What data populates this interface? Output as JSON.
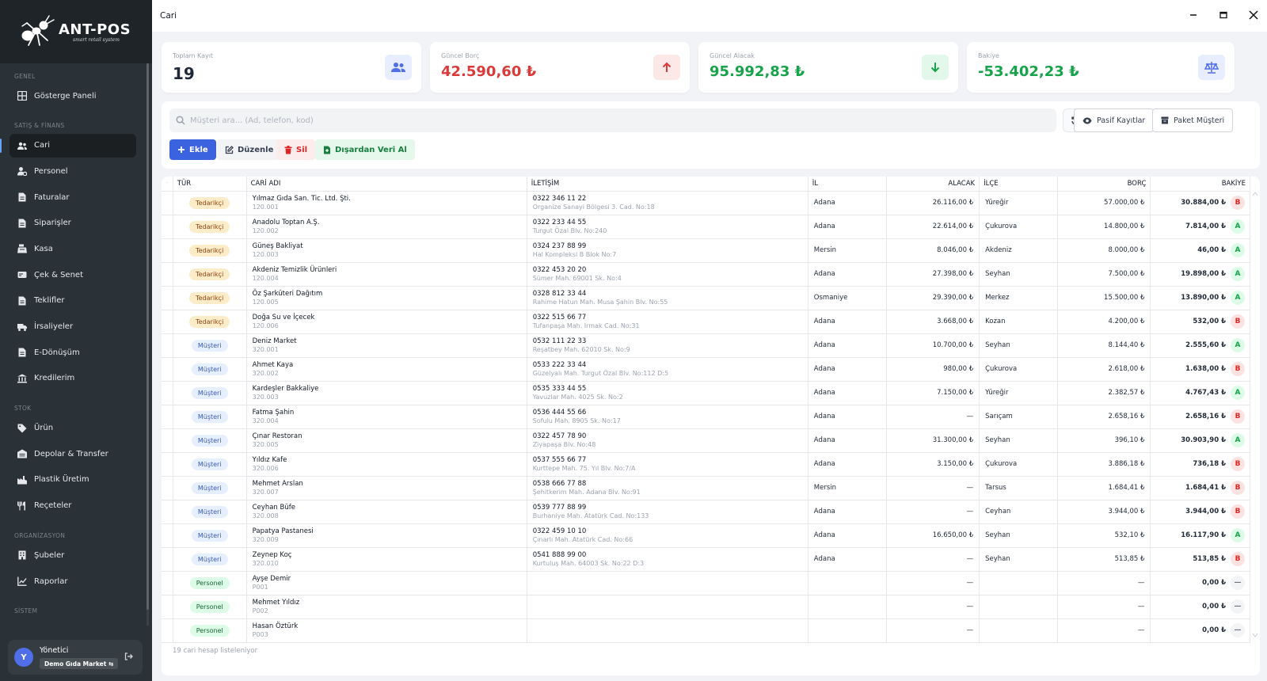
{
  "brand": {
    "name": "ANT-POS",
    "tagline": "smart retail system"
  },
  "sidebar": {
    "sections": [
      {
        "title": "GENEL",
        "items": [
          {
            "label": "Gösterge Paneli",
            "icon": "dashboard-icon"
          }
        ]
      },
      {
        "title": "SATIŞ & FİNANS",
        "items": [
          {
            "label": "Cari",
            "icon": "users-icon",
            "active": true
          },
          {
            "label": "Personel",
            "icon": "user-gear-icon"
          },
          {
            "label": "Faturalar",
            "icon": "document-icon"
          },
          {
            "label": "Siparişler",
            "icon": "document-icon"
          },
          {
            "label": "Kasa",
            "icon": "cash-register-icon"
          },
          {
            "label": "Çek & Senet",
            "icon": "check-card-icon"
          },
          {
            "label": "Teklifler",
            "icon": "document-icon"
          },
          {
            "label": "İrsaliyeler",
            "icon": "truck-icon"
          },
          {
            "label": "E-Dönüşüm",
            "icon": "document-icon"
          },
          {
            "label": "Kredilerim",
            "icon": "bank-icon"
          }
        ]
      },
      {
        "title": "STOK",
        "items": [
          {
            "label": "Ürün",
            "icon": "tag-icon"
          },
          {
            "label": "Depolar & Transfer",
            "icon": "warehouse-icon"
          },
          {
            "label": "Plastik Üretim",
            "icon": "factory-icon"
          },
          {
            "label": "Reçeteler",
            "icon": "utensils-icon"
          }
        ]
      },
      {
        "title": "ORGANİZASYON",
        "items": [
          {
            "label": "Şubeler",
            "icon": "building-icon"
          },
          {
            "label": "Raporlar",
            "icon": "chart-line-icon"
          }
        ]
      },
      {
        "title": "SİSTEM",
        "items": []
      }
    ],
    "user": {
      "initial": "Y",
      "name": "Yönetici",
      "company": "Demo Gıda Market ⇆"
    }
  },
  "window": {
    "title": "Cari"
  },
  "stats": {
    "total": {
      "label": "Toplam Kayıt",
      "value": "19",
      "color": "#111827"
    },
    "debt": {
      "label": "Güncel Borç",
      "value": "42.590,60 ₺",
      "color": "#dc3a3a"
    },
    "receivable": {
      "label": "Güncel Alacak",
      "value": "95.992,83 ₺",
      "color": "#16a34a"
    },
    "balance": {
      "label": "Bakiye",
      "value": "-53.402,23 ₺",
      "color": "#16a34a"
    }
  },
  "toolbar": {
    "search_placeholder": "Müşteri ara... (Ad, telefon, kod)",
    "passive": "Pasif Kayıtlar",
    "package": "Paket Müşteri",
    "add": "Ekle",
    "edit": "Düzenle",
    "delete": "Sil",
    "import": "Dışardan Veri Al"
  },
  "table": {
    "headers": {
      "tur": "TÜR",
      "ad": "CARİ ADI",
      "iletisim": "İLETİŞİM",
      "il": "İL",
      "alacak": "ALACAK",
      "ilce": "İLÇE",
      "borc": "BORÇ",
      "bakiye": "BAKİYE"
    },
    "rows": [
      {
        "type": "Tedarikçi",
        "t": "tedarikci",
        "name": "Yılmaz Gıda San. Tic. Ltd. Şti.",
        "code": "120.001",
        "phone": "0322 346 11 22",
        "address": "Organize Sanayi Bölgesi 3. Cad. No:18",
        "city": "Adana",
        "alacak": "26.116,00 ₺",
        "district": "Yüreğir",
        "borc": "57.000,00 ₺",
        "bakiye": "30.884,00 ₺",
        "badge": "B"
      },
      {
        "type": "Tedarikçi",
        "t": "tedarikci",
        "name": "Anadolu Toptan A.Ş.",
        "code": "120.002",
        "phone": "0322 233 44 55",
        "address": "Turgut Özal Blv. No:240",
        "city": "Adana",
        "alacak": "22.614,00 ₺",
        "district": "Çukurova",
        "borc": "14.800,00 ₺",
        "bakiye": "7.814,00 ₺",
        "badge": "A"
      },
      {
        "type": "Tedarikçi",
        "t": "tedarikci",
        "name": "Güneş Bakliyat",
        "code": "120.003",
        "phone": "0324 237 88 99",
        "address": "Hal Kompleksi B Blok No:7",
        "city": "Mersin",
        "alacak": "8.046,00 ₺",
        "district": "Akdeniz",
        "borc": "8.000,00 ₺",
        "bakiye": "46,00 ₺",
        "badge": "A"
      },
      {
        "type": "Tedarikçi",
        "t": "tedarikci",
        "name": "Akdeniz Temizlik Ürünleri",
        "code": "120.004",
        "phone": "0322 453 20 20",
        "address": "Sümer Mah. 69001 Sk. No:4",
        "city": "Adana",
        "alacak": "27.398,00 ₺",
        "district": "Seyhan",
        "borc": "7.500,00 ₺",
        "bakiye": "19.898,00 ₺",
        "badge": "A"
      },
      {
        "type": "Tedarikçi",
        "t": "tedarikci",
        "name": "Öz Şarküteri Dağıtım",
        "code": "120.005",
        "phone": "0328 812 33 44",
        "address": "Rahime Hatun Mah. Musa Şahin Blv. No:55",
        "city": "Osmaniye",
        "alacak": "29.390,00 ₺",
        "district": "Merkez",
        "borc": "15.500,00 ₺",
        "bakiye": "13.890,00 ₺",
        "badge": "A"
      },
      {
        "type": "Tedarikçi",
        "t": "tedarikci",
        "name": "Doğa Su ve İçecek",
        "code": "120.006",
        "phone": "0322 515 66 77",
        "address": "Tufanpaşa Mah. Irmak Cad. No:31",
        "city": "Adana",
        "alacak": "3.668,00 ₺",
        "district": "Kozan",
        "borc": "4.200,00 ₺",
        "bakiye": "532,00 ₺",
        "badge": "B"
      },
      {
        "type": "Müşteri",
        "t": "musteri",
        "name": "Deniz Market",
        "code": "320.001",
        "phone": "0532 111 22 33",
        "address": "Reşatbey Mah. 62010 Sk. No:9",
        "city": "Adana",
        "alacak": "10.700,00 ₺",
        "district": "Seyhan",
        "borc": "8.144,40 ₺",
        "bakiye": "2.555,60 ₺",
        "badge": "A"
      },
      {
        "type": "Müşteri",
        "t": "musteri",
        "name": "Ahmet Kaya",
        "code": "320.002",
        "phone": "0533 222 33 44",
        "address": "Güzelyalı Mah. Turgut Özal Blv. No:112 D:5",
        "city": "Adana",
        "alacak": "980,00 ₺",
        "district": "Çukurova",
        "borc": "2.618,00 ₺",
        "bakiye": "1.638,00 ₺",
        "badge": "B"
      },
      {
        "type": "Müşteri",
        "t": "musteri",
        "name": "Kardeşler Bakkaliye",
        "code": "320.003",
        "phone": "0535 333 44 55",
        "address": "Yavuzlar Mah. 4025 Sk. No:2",
        "city": "Adana",
        "alacak": "7.150,00 ₺",
        "district": "Yüreğir",
        "borc": "2.382,57 ₺",
        "bakiye": "4.767,43 ₺",
        "badge": "A"
      },
      {
        "type": "Müşteri",
        "t": "musteri",
        "name": "Fatma Şahin",
        "code": "320.004",
        "phone": "0536 444 55 66",
        "address": "Sofulu Mah. 8905 Sk. No:17",
        "city": "Adana",
        "alacak": "—",
        "district": "Sarıçam",
        "borc": "2.658,16 ₺",
        "bakiye": "2.658,16 ₺",
        "badge": "B"
      },
      {
        "type": "Müşteri",
        "t": "musteri",
        "name": "Çınar Restoran",
        "code": "320.005",
        "phone": "0322 457 78 90",
        "address": "Ziyapaşa Blv. No:48",
        "city": "Adana",
        "alacak": "31.300,00 ₺",
        "district": "Seyhan",
        "borc": "396,10 ₺",
        "bakiye": "30.903,90 ₺",
        "badge": "A"
      },
      {
        "type": "Müşteri",
        "t": "musteri",
        "name": "Yıldız Kafe",
        "code": "320.006",
        "phone": "0537 555 66 77",
        "address": "Kurttepe Mah. 75. Yıl Blv. No:7/A",
        "city": "Adana",
        "alacak": "3.150,00 ₺",
        "district": "Çukurova",
        "borc": "3.886,18 ₺",
        "bakiye": "736,18 ₺",
        "badge": "B"
      },
      {
        "type": "Müşteri",
        "t": "musteri",
        "name": "Mehmet Arslan",
        "code": "320.007",
        "phone": "0538 666 77 88",
        "address": "Şehitkerim Mah. Adana Blv. No:91",
        "city": "Mersin",
        "alacak": "—",
        "district": "Tarsus",
        "borc": "1.684,41 ₺",
        "bakiye": "1.684,41 ₺",
        "badge": "B"
      },
      {
        "type": "Müşteri",
        "t": "musteri",
        "name": "Ceyhan Büfe",
        "code": "320.008",
        "phone": "0539 777 88 99",
        "address": "Burhaniye Mah. Atatürk Cad. No:133",
        "city": "Adana",
        "alacak": "—",
        "district": "Ceyhan",
        "borc": "3.944,00 ₺",
        "bakiye": "3.944,00 ₺",
        "badge": "B"
      },
      {
        "type": "Müşteri",
        "t": "musteri",
        "name": "Papatya Pastanesi",
        "code": "320.009",
        "phone": "0322 459 10 10",
        "address": "Çınarlı Mah. Atatürk Cad. No:66",
        "city": "Adana",
        "alacak": "16.650,00 ₺",
        "district": "Seyhan",
        "borc": "532,10 ₺",
        "bakiye": "16.117,90 ₺",
        "badge": "A"
      },
      {
        "type": "Müşteri",
        "t": "musteri",
        "name": "Zeynep Koç",
        "code": "320.010",
        "phone": "0541 888 99 00",
        "address": "Kurtuluş Mah. 64003 Sk. No:22 D:3",
        "city": "Adana",
        "alacak": "—",
        "district": "Seyhan",
        "borc": "513,85 ₺",
        "bakiye": "513,85 ₺",
        "badge": "B"
      },
      {
        "type": "Personel",
        "t": "personel",
        "name": "Ayşe Demir",
        "code": "P001",
        "phone": "",
        "address": "",
        "city": "",
        "alacak": "—",
        "district": "",
        "borc": "—",
        "bakiye": "0,00 ₺",
        "badge": "—"
      },
      {
        "type": "Personel",
        "t": "personel",
        "name": "Mehmet Yıldız",
        "code": "P002",
        "phone": "",
        "address": "",
        "city": "",
        "alacak": "—",
        "district": "",
        "borc": "—",
        "bakiye": "0,00 ₺",
        "badge": "—"
      },
      {
        "type": "Personel",
        "t": "personel",
        "name": "Hasan Öztürk",
        "code": "P003",
        "phone": "",
        "address": "",
        "city": "",
        "alacak": "—",
        "district": "",
        "borc": "—",
        "bakiye": "0,00 ₺",
        "badge": "—"
      }
    ],
    "footer": "19 cari hesap listeleniyor"
  }
}
